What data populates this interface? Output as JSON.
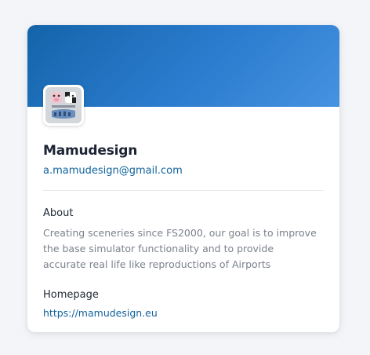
{
  "profile": {
    "name": "Mamudesign",
    "email": "a.mamudesign@gmail.com",
    "avatar_icon": "mamudesign-logo-icon"
  },
  "about": {
    "label": "About",
    "text": "Creating sceneries since FS2000, our goal is to improve the base simulator functionality and to provide accurate real life like reproductions of Airports"
  },
  "homepage": {
    "label": "Homepage",
    "url": "https://mamudesign.eu"
  },
  "colors": {
    "banner_start": "#1464aa",
    "banner_end": "#4592e0",
    "link": "#11639c",
    "page_background": "#f4f5f8"
  }
}
